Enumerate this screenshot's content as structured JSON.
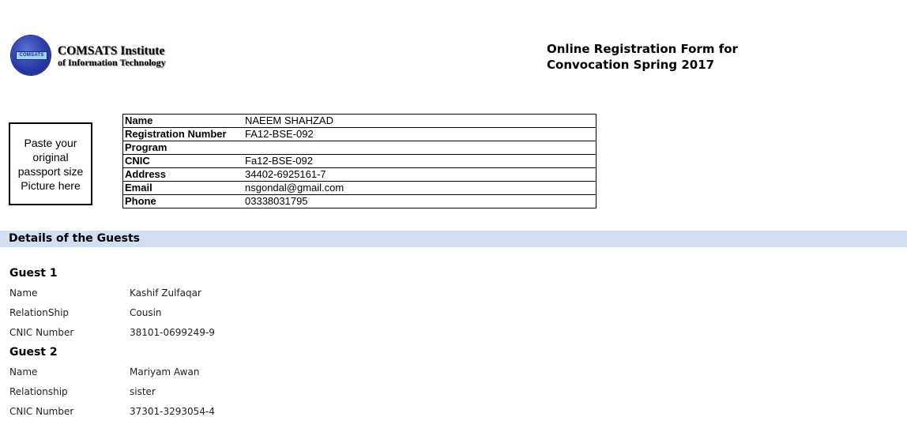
{
  "logo": {
    "badge_text": "COMSATS",
    "title": "COMSATS Institute",
    "subtitle": "of Information Technology"
  },
  "form_title": {
    "line1": "Online Registration Form for",
    "line2": "Convocation Spring 2017"
  },
  "photo_placeholder": "Paste your original passport size  Picture here",
  "student": {
    "rows": [
      {
        "label": "Name",
        "value": "NAEEM SHAHZAD"
      },
      {
        "label": "Registration Number",
        "value": "FA12-BSE-092"
      },
      {
        "label": "Program",
        "value": ""
      },
      {
        "label": "CNIC",
        "value": "Fa12-BSE-092"
      },
      {
        "label": "Address",
        "value": "34402-6925161-7"
      },
      {
        "label": "Email",
        "value": "nsgondal@gmail.com"
      },
      {
        "label": "Phone",
        "value": "03338031795"
      }
    ]
  },
  "guests_section": {
    "title": "Details of the Guests",
    "guests": [
      {
        "heading": "Guest 1",
        "name_label": "Name",
        "name": "Kashif Zulfaqar",
        "relationship_label": "RelationShip",
        "relationship": "Cousin",
        "cnic_label": "CNIC Number",
        "cnic": "38101-0699249-9"
      },
      {
        "heading": "Guest 2",
        "name_label": "Name",
        "name": "Mariyam Awan",
        "relationship_label": "Relationship",
        "relationship": "sister",
        "cnic_label": "CNIC Number",
        "cnic": "37301-3293054-4"
      }
    ]
  },
  "colors": {
    "section_bar": "#d3dff0",
    "logo_blue": "#2a3aa8"
  }
}
